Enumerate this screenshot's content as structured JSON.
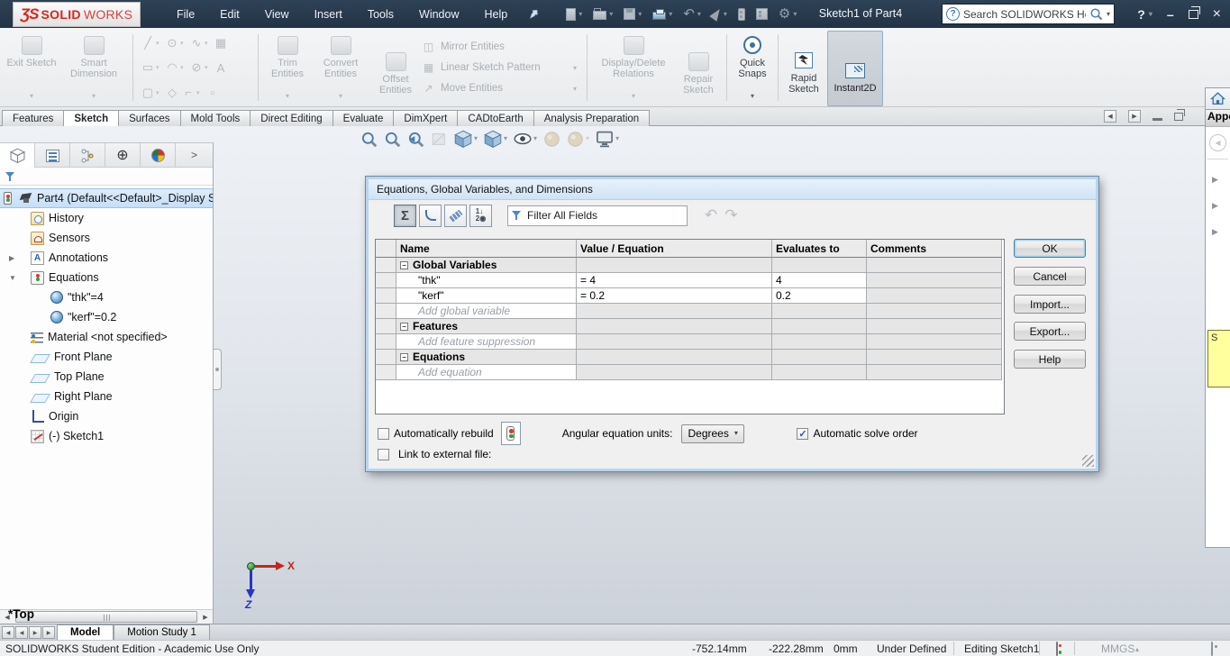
{
  "icons": {
    "dropdown": "▾",
    "chevron": ">",
    "undo": "↶",
    "redo": "↷",
    "gear": "⚙",
    "help": "?",
    "minimize": "–",
    "close": "×",
    "left_arrow": "◀",
    "right_arrow": "▶",
    "twisty_open": "▼",
    "twisty_closed": "▶",
    "check": "✓",
    "sigma": "Σ",
    "ordered": "1↓\n2◉",
    "minus": "−",
    "target": "⊕",
    "up_small": "▴",
    "grid": [
      "╱",
      "⊙",
      "∿",
      "▦",
      "▭",
      "◠",
      "⊘",
      "A",
      "▢",
      "◇",
      "⌐",
      "▫"
    ],
    "mirror": "◫",
    "pattern": "▦",
    "move": "↗"
  },
  "titlebar": {
    "logo_mark": "ƷS",
    "logo_bold": "SOLID",
    "logo_light": "WORKS",
    "menus": [
      "File",
      "Edit",
      "View",
      "Insert",
      "Tools",
      "Window",
      "Help"
    ],
    "doc_title": "Sketch1 of Part4",
    "search_value": "Search SOLIDWORKS Help"
  },
  "ribbon": {
    "exit_sketch": "Exit Sketch",
    "smart_dimension": "Smart Dimension",
    "trim_entities": "Trim Entities",
    "convert_entities": "Convert Entities",
    "offset_entities": "Offset Entities",
    "mirror_entities": "Mirror Entities",
    "linear_sketch_pattern": "Linear Sketch Pattern",
    "move_entities": "Move Entities",
    "display_delete_relations": "Display/Delete Relations",
    "repair_sketch": "Repair Sketch",
    "quick_snaps": "Quick Snaps",
    "rapid_sketch": "Rapid Sketch",
    "instant2d": "Instant2D"
  },
  "command_tabs": [
    "Features",
    "Sketch",
    "Surfaces",
    "Mold Tools",
    "Direct Editing",
    "Evaluate",
    "DimXpert",
    "CADtoEarth",
    "Analysis Preparation"
  ],
  "tree": {
    "root": "Part4 (Default<<Default>_Display S",
    "items": {
      "history": "History",
      "sensors": "Sensors",
      "annotations": "Annotations",
      "equations": "Equations",
      "thk": "\"thk\"=4",
      "kerf": "\"kerf\"=0.2",
      "material": "Material <not specified>",
      "front_plane": "Front Plane",
      "top_plane": "Top Plane",
      "right_plane": "Right Plane",
      "origin": "Origin",
      "sketch1": "(-) Sketch1"
    }
  },
  "dialog": {
    "title": "Equations, Global Variables, and Dimensions",
    "filter_value": "Filter All Fields",
    "table": {
      "headers": [
        "Name",
        "Value / Equation",
        "Evaluates to",
        "Comments"
      ],
      "rows": [
        {
          "type": "group",
          "name": "Global Variables",
          "value": "",
          "evaluates": "",
          "comments": ""
        },
        {
          "type": "data",
          "name": "\"thk\"",
          "value": "= 4",
          "evaluates": "4",
          "comments": ""
        },
        {
          "type": "data",
          "name": "\"kerf\"",
          "value": "= 0.2",
          "evaluates": "0.2",
          "comments": ""
        },
        {
          "type": "placeholder",
          "name": "Add global variable",
          "value": "",
          "evaluates": "",
          "comments": ""
        },
        {
          "type": "group",
          "name": "Features",
          "value": "",
          "evaluates": "",
          "comments": ""
        },
        {
          "type": "placeholder",
          "name": "Add feature suppression",
          "value": "",
          "evaluates": "",
          "comments": ""
        },
        {
          "type": "group",
          "name": "Equations",
          "value": "",
          "evaluates": "",
          "comments": ""
        },
        {
          "type": "placeholder",
          "name": "Add equation",
          "value": "",
          "evaluates": "",
          "comments": ""
        }
      ]
    },
    "buttons": {
      "ok": "OK",
      "cancel": "Cancel",
      "import": "Import...",
      "export": "Export...",
      "help": "Help"
    },
    "footer": {
      "auto_rebuild": "Automatically rebuild",
      "angular_units_label": "Angular equation units:",
      "angular_units_value": "Degrees",
      "auto_solve": "Automatic solve order",
      "link_external": "Link to external file:"
    }
  },
  "graphics": {
    "view_label": "*Top",
    "axis_x": "X",
    "axis_z": "Z"
  },
  "task_pane": {
    "header": "Appe",
    "swatch_label": "S"
  },
  "bottom_bar": {
    "model_tab": "Model",
    "motion_tab": "Motion Study 1"
  },
  "status": {
    "left": "SOLIDWORKS Student Edition - Academic Use Only",
    "x": "-752.14mm",
    "y": "-222.28mm",
    "z": "0mm",
    "define_state": "Under Defined",
    "editing": "Editing Sketch1",
    "units": "MMGS"
  }
}
